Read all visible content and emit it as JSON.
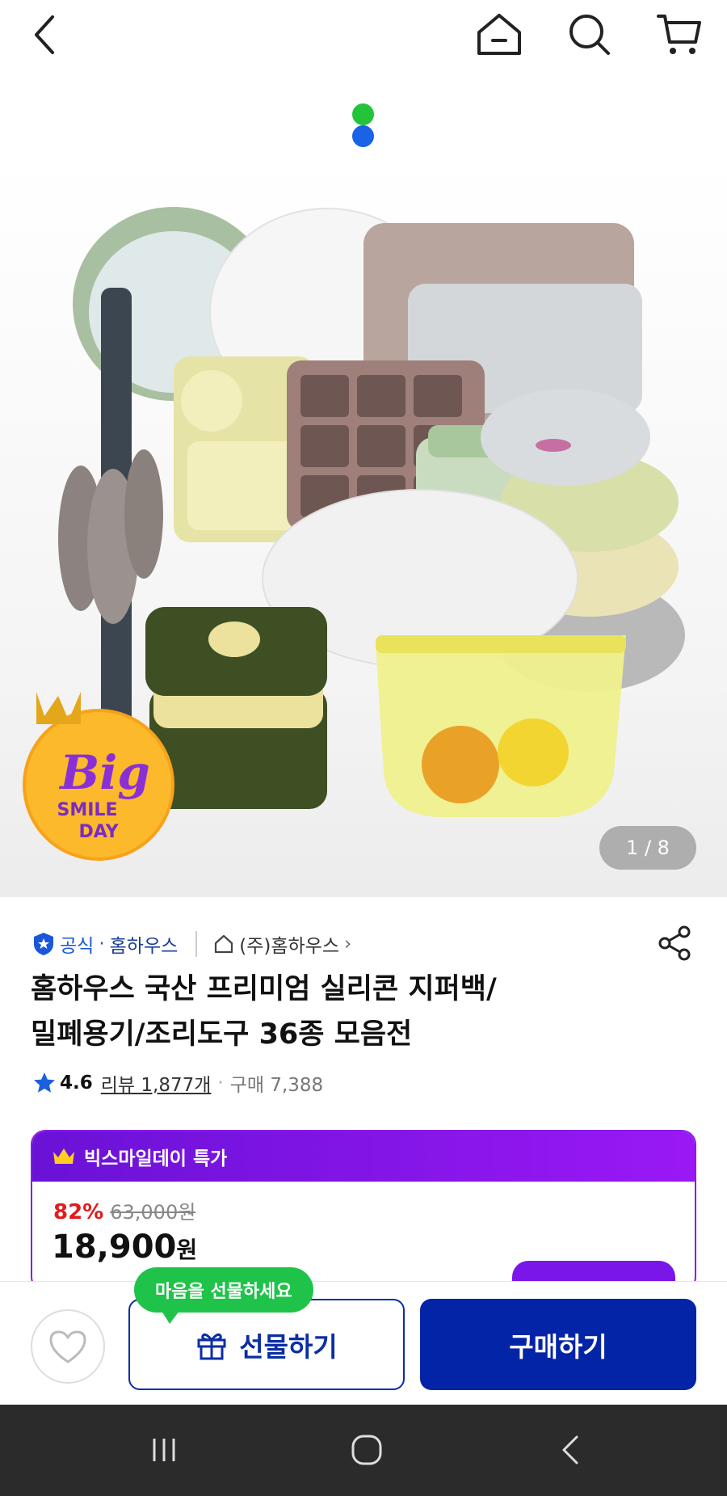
{
  "topbar": {
    "icons": [
      "chevron-left-icon",
      "home-icon",
      "search-icon",
      "cart-icon"
    ]
  },
  "image_pager": {
    "counter_text": "1 / 8",
    "current": 1,
    "total": 8,
    "dot_colors": [
      "#23c43b",
      "#1a62e6"
    ]
  },
  "hero": {
    "promo_badge": {
      "line1": "Big",
      "line2": "SMILE",
      "line3": "DAY"
    }
  },
  "brand": {
    "official_label": "공식",
    "separator": "·",
    "brand_name": "홈하우스",
    "store_name": "(주)홈하우스",
    "store_arrow": "›"
  },
  "product": {
    "title_line1": "홈하우스 국산 프리미엄 실리콘 지퍼백/",
    "title_line2": "밀폐용기/조리도구 36종 모음전"
  },
  "rating": {
    "score": "4.6",
    "review_text": "리뷰 1,877개",
    "separator": "·",
    "purchase_text": "구매 7,388"
  },
  "deal": {
    "header": "빅스마일데이 특가",
    "discount": "82%",
    "original_price": "63,000원",
    "sale_price_number": "18,900",
    "sale_price_unit": "원"
  },
  "actions": {
    "tooltip": "마음을 선물하세요",
    "gift_label": "선물하기",
    "buy_label": "구매하기"
  },
  "colors": {
    "primary_blue": "#0424a8",
    "deal_purple": "#8a19e8",
    "discount_red": "#e21b1b",
    "tooltip_green": "#1fc34a"
  }
}
